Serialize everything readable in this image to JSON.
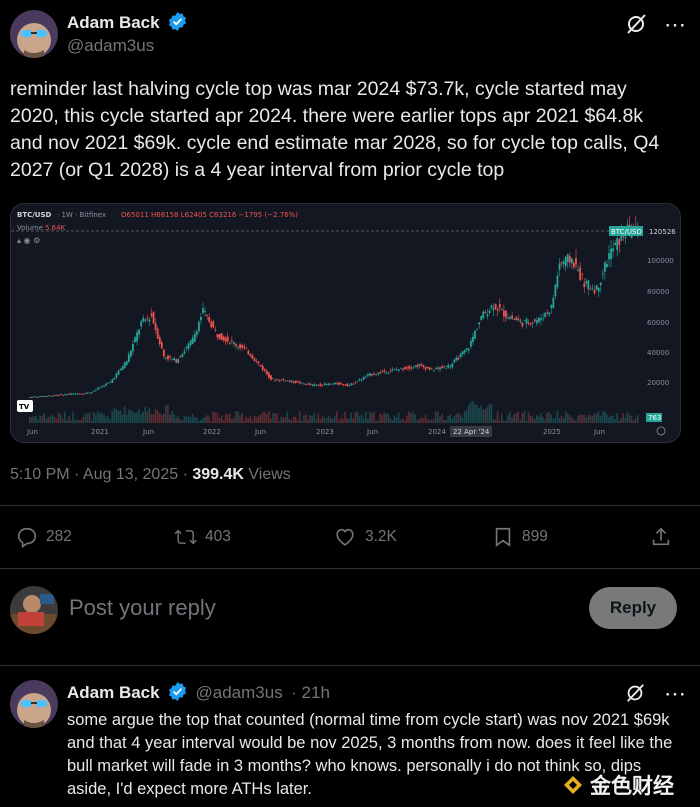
{
  "tweet": {
    "author_name": "Adam Back",
    "author_handle": "@adam3us",
    "text": "reminder last halving cycle top was mar 2024 $73.7k, cycle started may 2020, this cycle started apr 2024. there were earlier tops apr 2021 $64.8k and nov 2021 $69k. cycle end estimate mar 2028, so for cycle top calls, Q4 2027 (or Q1 2028) is a 4 year interval from prior cycle top",
    "time": "5:10 PM · Aug 13, 2025 · ",
    "views_count": "399.4K",
    "views_label": " Views",
    "replies": "282",
    "reposts": "403",
    "likes": "3.2K",
    "bookmarks": "899"
  },
  "chart": {
    "symbol": "BTC/USD",
    "interval": "· 1W · Bitfinex",
    "ohlc": "O65011 H68158 L62405 C63216 −1795 (−2.76%)",
    "volume_label": "Volume",
    "volume_value": "5.64K",
    "price_tag_label": "BTC/USD",
    "price_tag_value": "120526",
    "volume_tag": "763",
    "y_ticks": [
      "100000",
      "80000",
      "60000",
      "40000",
      "20000"
    ],
    "x_ticks": [
      "Jun",
      "2021",
      "Jun",
      "2022",
      "Jun",
      "2023",
      "Jun",
      "2024",
      "22 Apr '24",
      "2025",
      "Jun"
    ],
    "colors": {
      "up": "#26a69a",
      "down": "#ef5350",
      "bg": "#131722"
    }
  },
  "composer": {
    "placeholder": "Post your reply",
    "button": "Reply"
  },
  "reply": {
    "author_name": "Adam Back",
    "author_handle": "@adam3us",
    "time": "· 21h",
    "text": "some argue the top that counted (normal time from cycle start) was nov 2021 $69k and that 4 year interval would be nov 2025, 3 months from now. does it feel like the bull market will fade in 3 months? who knows. personally i do not think so, dips aside, I'd expect more ATHs later.",
    "watermark": "金色财经"
  }
}
